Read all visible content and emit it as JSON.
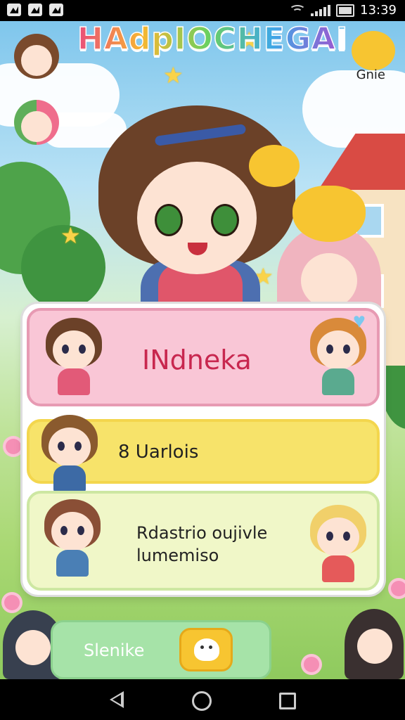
{
  "status_bar": {
    "time": "13:39",
    "left_icons": [
      "image-icon",
      "image-icon",
      "download-icon"
    ]
  },
  "header": {
    "title": "HAdpIOCHEGAI",
    "corner_label": "Gnie"
  },
  "menu": {
    "items": [
      {
        "label": "INdneka"
      },
      {
        "label": "8 Uarlois"
      },
      {
        "label_line1": "Rdastrio oujivle",
        "label_line2": "lumemiso"
      }
    ]
  },
  "bottom_bar": {
    "label": "Slenike",
    "button_icon": "ghost-icon"
  },
  "nav_bar": {
    "icons": [
      "back-triangle-icon",
      "home-circle-icon",
      "recent-square-icon"
    ]
  },
  "colors": {
    "card_pink": "#f9c6d6",
    "card_yellow": "#f7e36a",
    "card_green": "#f0f7c8",
    "label_pink": "#c8274f",
    "bottom_green": "#a6e3a8",
    "accent_yellow": "#f7c531"
  }
}
